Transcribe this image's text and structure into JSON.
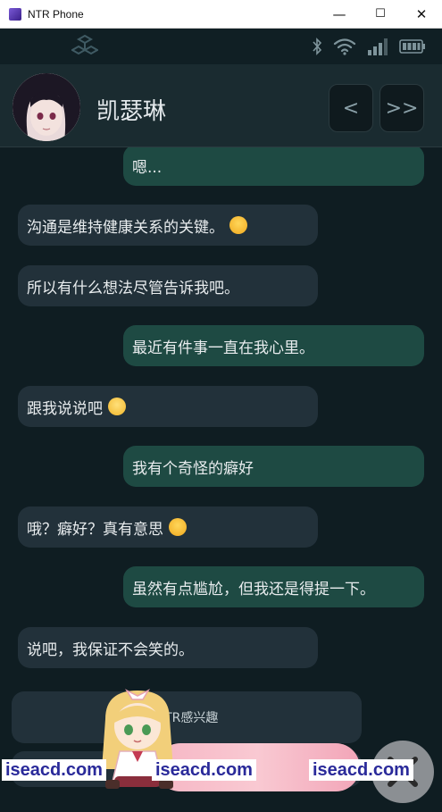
{
  "window": {
    "title": "NTR Phone",
    "minimize": "—",
    "maximize": "☐",
    "close": "✕"
  },
  "status": {
    "icons": [
      "cube-icon",
      "bluetooth-icon",
      "wifi-icon",
      "signal-icon",
      "battery-icon"
    ]
  },
  "header": {
    "contact_name": "凯瑟琳",
    "prev_label": "<",
    "skip_label": ">>"
  },
  "messages": [
    {
      "side": "out",
      "text": "嗯..."
    },
    {
      "side": "in",
      "text": "沟通是维持健康关系的关键。",
      "emoji": "hugging-emoji"
    },
    {
      "side": "in",
      "text": "所以有什么想法尽管告诉我吧。"
    },
    {
      "side": "out",
      "text": "最近有件事一直在我心里。"
    },
    {
      "side": "in",
      "text": "跟我说说吧",
      "emoji": "smile-emoji"
    },
    {
      "side": "out",
      "text": "我有个奇怪的癖好"
    },
    {
      "side": "in",
      "text": "哦？癖好？真有意思",
      "emoji": "wink-tongue-emoji"
    },
    {
      "side": "out",
      "text": "虽然有点尴尬，但我还是得提一下。"
    },
    {
      "side": "in",
      "text": "说吧，我保证不会笑的。"
    }
  ],
  "choices": [
    {
      "text": "NTR感兴趣"
    }
  ],
  "watermark": {
    "text": "iseacd.com"
  },
  "colors": {
    "background": "#0f1d22",
    "incoming_bubble": "#22313a",
    "outgoing_bubble": "#1e4a43",
    "header": "#1a2b30"
  }
}
